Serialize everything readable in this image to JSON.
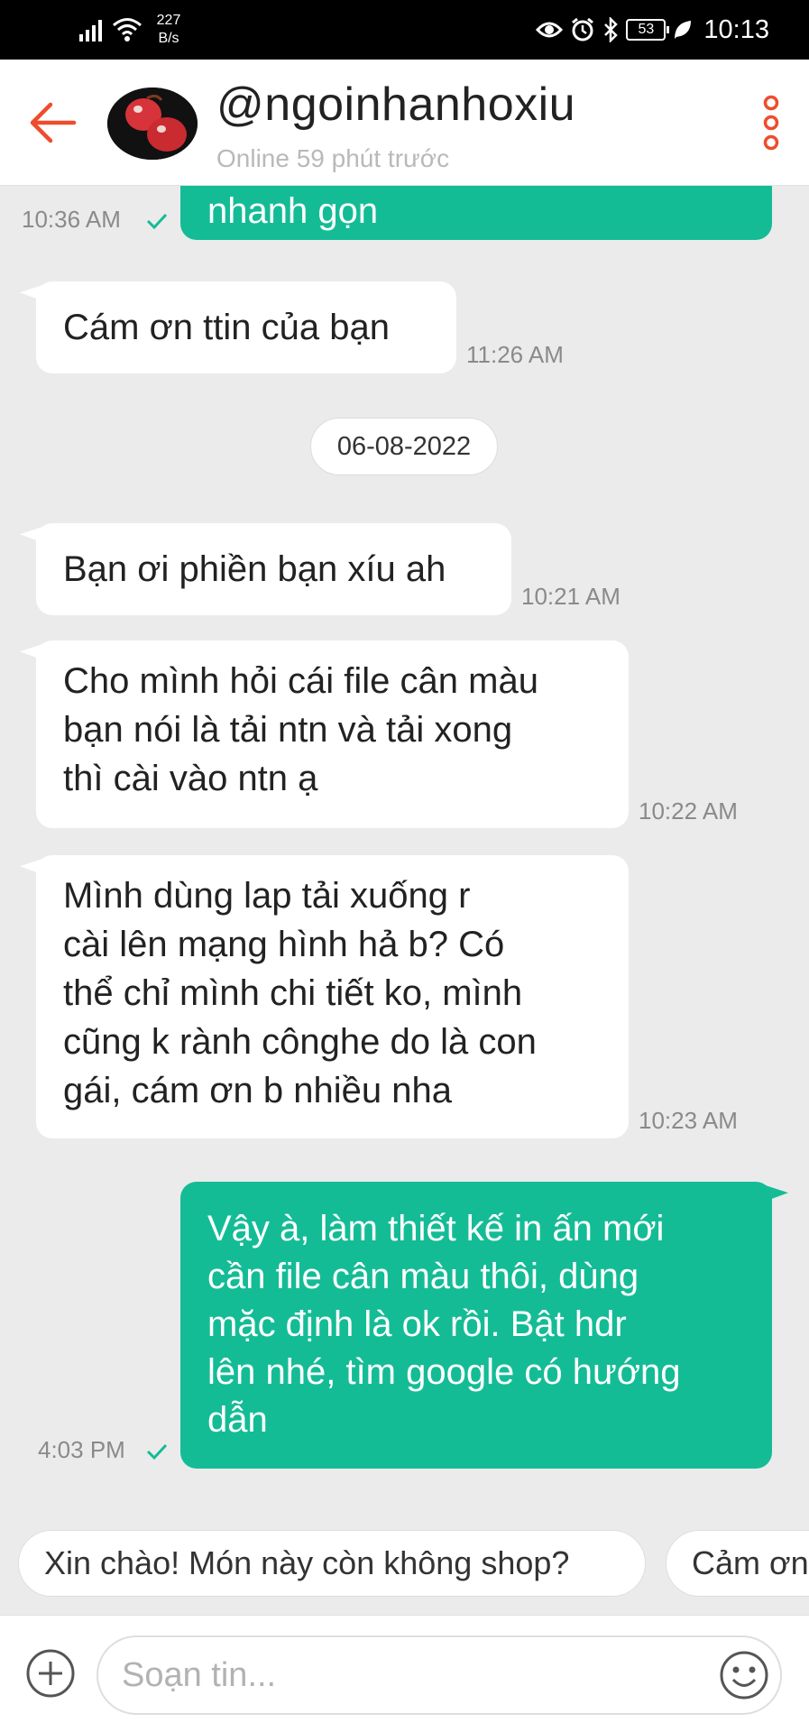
{
  "status_bar": {
    "net_speed_value": "227",
    "net_speed_unit": "B/s",
    "battery": "53",
    "time": "10:13"
  },
  "header": {
    "username": "@ngoinhanhoxiu",
    "status": "Online 59 phút trước"
  },
  "messages": [
    {
      "direction": "out",
      "text": "nhanh gọn",
      "time": "10:36 AM",
      "read": true
    },
    {
      "direction": "in",
      "text": "Cám ơn ttin của bạn",
      "time": "11:26 AM"
    },
    {
      "direction": "in",
      "text": "Bạn ơi phiền bạn xíu ah",
      "time": "10:21 AM"
    },
    {
      "direction": "in",
      "lines": [
        "Cho mình hỏi cái file cân màu",
        "bạn nói là tải ntn và tải xong",
        "thì cài vào ntn ạ"
      ],
      "time": "10:22 AM"
    },
    {
      "direction": "in",
      "lines": [
        "Mình dùng lap tải xuống r",
        "cài lên mạng hình hả b? Có",
        "thể chỉ mình chi tiết ko, mình",
        "cũng k rành cônghe do là con",
        "gái, cám ơn b nhiều nha"
      ],
      "time": "10:23 AM"
    },
    {
      "direction": "out",
      "lines": [
        "Vậy à, làm thiết kế in ấn mới",
        "cần file cân màu thôi, dùng",
        "mặc định là ok rồi. Bật hdr",
        "lên nhé, tìm google có hướng",
        "dẫn"
      ],
      "time": "4:03 PM",
      "read": true
    }
  ],
  "date_separator": "06-08-2022",
  "quick_replies": [
    "Xin chào! Món này còn không shop?",
    "Cảm ơn"
  ],
  "composer": {
    "placeholder": "Soạn tin..."
  },
  "colors": {
    "accent_orange": "#ee4d2d",
    "outgoing_bubble": "#14bc96",
    "read_check": "#14bc96"
  },
  "icons": [
    "back-arrow-icon",
    "more-vertical-icon",
    "read-check-icon",
    "add-icon",
    "emoji-icon",
    "signal-icon",
    "wifi-icon",
    "eye-icon",
    "alarm-icon",
    "bluetooth-icon",
    "battery-icon",
    "leaf-icon"
  ]
}
